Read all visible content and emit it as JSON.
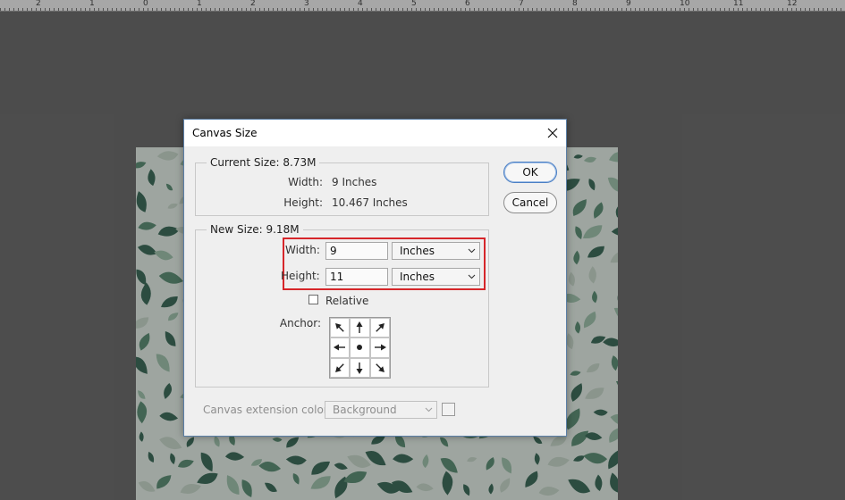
{
  "ruler": {
    "labels": [
      "2",
      "1",
      "0",
      "1",
      "2",
      "3",
      "4",
      "5",
      "6",
      "7",
      "8",
      "9",
      "10",
      "11",
      "12"
    ]
  },
  "dialog": {
    "title": "Canvas Size",
    "current_size": {
      "legend": "Current Size: 8.73M",
      "width_label": "Width:",
      "width_value": "9 Inches",
      "height_label": "Height:",
      "height_value": "10.467 Inches"
    },
    "new_size": {
      "legend": "New Size: 9.18M",
      "width_label": "Width:",
      "width_value": "9",
      "width_unit": "Inches",
      "height_label": "Height:",
      "height_value": "11",
      "height_unit": "Inches",
      "relative_label": "Relative",
      "relative_checked": false,
      "anchor_label": "Anchor:"
    },
    "buttons": {
      "ok": "OK",
      "cancel": "Cancel"
    },
    "extension": {
      "label": "Canvas extension color:",
      "value": "Background"
    }
  },
  "colors": {
    "canvas_bg": "#e3ece6",
    "leaf_dark": "#3f6e5c",
    "leaf_mid": "#5f9077",
    "leaf_light": "#9fc2ad",
    "leaf_pale": "#c6d6c9",
    "highlight": "#d6262a"
  },
  "icons": {
    "close": "close-icon",
    "chevron": "chevron-down-icon",
    "anchor": [
      "arrow-nw-icon",
      "arrow-n-icon",
      "arrow-ne-icon",
      "arrow-w-icon",
      "dot-icon",
      "arrow-e-icon",
      "arrow-sw-icon",
      "arrow-s-icon",
      "arrow-se-icon"
    ]
  }
}
